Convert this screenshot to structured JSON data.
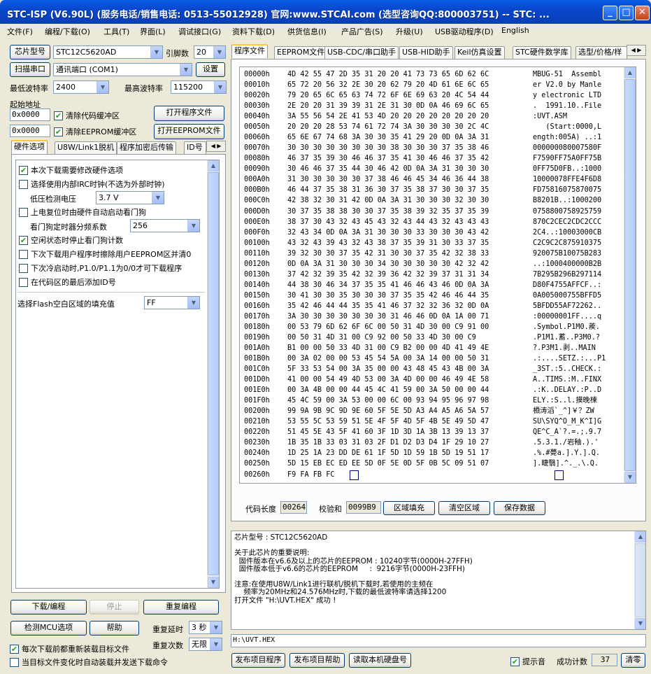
{
  "window": {
    "title": "STC-ISP (V6.90L) (服务电话/销售电话: 0513-55012928) 官网:www.STCAI.com (选型咨询QQ:800003751) -- STC: ..."
  },
  "menu": [
    "文件(F)",
    "编程/下载(O)",
    "工具(T)",
    "界面(L)",
    "调试接口(G)",
    "资料下载(D)",
    "供货信息(I)",
    "产品广告(S)",
    "升级(U)",
    "USB驱动程序(D)",
    "English"
  ],
  "left": {
    "chip_model_btn": "芯片型号",
    "chip_model_value": "STC12C5620AD",
    "pin_label": "引脚数",
    "pin_value": "20",
    "scan_port_btn": "扫描串口",
    "port_value": "通讯端口 (COM1)",
    "settings_btn": "设置",
    "min_baud_label": "最低波特率",
    "min_baud_value": "2400",
    "max_baud_label": "最高波特率",
    "max_baud_value": "115200",
    "start_addr_label": "起始地址",
    "addr1": "0x0000",
    "clear_code_buffer": "清除代码缓冲区",
    "open_program_btn": "打开程序文件",
    "addr2": "0x0000",
    "clear_eeprom_buffer": "清除EEPROM缓冲区",
    "open_eeprom_btn": "打开EEPROM文件",
    "tabs": [
      "硬件选项",
      "U8W/Link1脱机",
      "程序加密后传输",
      "ID号"
    ],
    "hw": {
      "opt1": "本次下载需要修改硬件选项",
      "opt2": "选择使用内部IRC时钟(不选为外部时钟)",
      "voltage_label": "低压检测电压",
      "voltage_value": "3.7 V",
      "opt3": "上电复位时由硬件自动启动看门狗",
      "wdt_label": "看门狗定时器分频系数",
      "wdt_value": "256",
      "opt4": "空闲状态时停止看门狗计数",
      "opt5": "下次下载用户程序时擦除用户EEPROM区并清0",
      "opt6": "下次冷启动时,P1.0/P1.1为0/0才可下载程序",
      "opt7": "在代码区的最后添加ID号",
      "fill_label": "选择Flash空白区域的填充值",
      "fill_value": "FF"
    },
    "download_btn": "下载/编程",
    "stop_btn": "停止",
    "reprogram_btn": "重复编程",
    "detect_btn": "检测MCU选项",
    "help_btn": "帮助",
    "repeat_delay_label": "重复延时",
    "repeat_delay_value": "3 秒",
    "repeat_count_label": "重复次数",
    "repeat_count_value": "无限",
    "reload_each": "每次下载前都重新装载目标文件",
    "auto_send": "当目标文件变化时自动装载并发送下载命令"
  },
  "right": {
    "tabs": [
      "程序文件",
      "EEPROM文件",
      "USB-CDC/串口助手",
      "USB-HID助手",
      "Keil仿真设置",
      "STC硬件数学库",
      "选型/价格/样"
    ],
    "hex": [
      [
        "00000h",
        "4D 42 55 47 2D 35 31 20 20 41 73 73 65 6D 62 6C",
        "MBUG-51  Assembl"
      ],
      [
        "00010h",
        "65 72 20 56 32 2E 30 20 62 79 20 4D 61 6E 6C 65",
        "er V2.0 by Manle"
      ],
      [
        "00020h",
        "79 20 65 6C 65 63 74 72 6F 6E 69 63 20 4C 54 44",
        "y electronic LTD"
      ],
      [
        "00030h",
        "2E 20 20 31 39 39 31 2E 31 30 0D 0A 46 69 6C 65",
        ".  1991.10..File"
      ],
      [
        "00040h",
        "3A 55 56 54 2E 41 53 4D 20 20 20 20 20 20 20 20",
        ":UVT.ASM        "
      ],
      [
        "00050h",
        "20 20 20 28 53 74 61 72 74 3A 30 30 30 30 2C 4C",
        "   (Start:0000,L"
      ],
      [
        "00060h",
        "65 6E 67 74 68 3A 30 30 35 41 29 20 0D 0A 3A 31",
        "ength:005A) ..:1"
      ],
      [
        "00070h",
        "30 30 30 30 30 30 30 30 38 30 30 30 37 35 38 46",
        "000000080007580F"
      ],
      [
        "00080h",
        "46 37 35 39 30 46 46 37 35 41 30 46 46 37 35 42",
        "F7590FF75A0FF75B"
      ],
      [
        "00090h",
        "30 46 46 37 35 44 30 46 42 0D 0A 3A 31 30 30 30",
        "0FF75D0FB..:1000"
      ],
      [
        "000A0h",
        "31 30 30 30 30 30 37 38 46 46 45 34 46 36 44 38",
        "10000078FFE4F6D8"
      ],
      [
        "000B0h",
        "46 44 37 35 38 31 36 30 37 35 38 37 30 30 37 35",
        "FD75816075870075"
      ],
      [
        "000C0h",
        "42 38 32 30 31 42 0D 0A 3A 31 30 30 30 32 30 30",
        "B8201B..:1000200"
      ],
      [
        "000D0h",
        "30 37 35 38 38 30 30 37 35 38 39 32 35 37 35 39",
        "0758800758925759"
      ],
      [
        "000E0h",
        "38 37 30 43 32 43 45 43 32 43 44 43 32 43 43 43",
        "870C2CEC2CDC2CCC"
      ],
      [
        "000F0h",
        "32 43 34 0D 0A 3A 31 30 30 30 33 30 30 30 43 42",
        "2C4..:10003000CB"
      ],
      [
        "00100h",
        "43 32 43 39 43 32 43 38 37 35 39 31 30 33 37 35",
        "C2C9C2C875910375"
      ],
      [
        "00110h",
        "39 32 30 30 37 35 42 31 30 30 37 35 42 32 38 33",
        "920075B10075B283"
      ],
      [
        "00120h",
        "0D 0A 3A 31 30 30 30 34 30 30 30 30 30 42 32 42",
        "..:1000400000B2B"
      ],
      [
        "00130h",
        "37 42 32 39 35 42 32 39 36 42 32 39 37 31 31 34",
        "7B295B296B297114"
      ],
      [
        "00140h",
        "44 38 30 46 34 37 35 35 41 46 46 43 46 0D 0A 3A",
        "D80F4755AFFCF..:"
      ],
      [
        "00150h",
        "30 41 30 30 35 30 30 30 37 35 35 42 46 46 44 35",
        "0A005000755BFFD5"
      ],
      [
        "00160h",
        "35 42 46 44 44 35 35 41 46 37 32 32 36 32 0D 0A",
        "5BFDD55AF72262.."
      ],
      [
        "00170h",
        "3A 30 30 30 30 30 30 30 31 46 46 0D 0A 1A 00 71",
        ":00000001FF....q"
      ],
      [
        "00180h",
        "00 53 79 6D 62 6F 6C 00 50 31 4D 30 00 C9 91 00",
        ".Symbol.P1M0.蒺."
      ],
      [
        "00190h",
        "00 50 31 4D 31 00 C9 92 00 50 33 4D 30 00 C9",
        ".P1M1.蓄..P3M0.?"
      ],
      [
        "001A0h",
        "B1 00 00 50 33 4D 31 00 C9 B2 00 00 4D 41 49 4E",
        "?.P3M1.剥..MAIN"
      ],
      [
        "001B0h",
        "00 3A 02 00 00 53 45 54 5A 00 3A 14 00 00 50 31",
        ".:....SETZ.:...P1"
      ],
      [
        "001C0h",
        "5F 33 53 54 00 3A 35 00 00 43 48 45 43 4B 00 3A",
        "_3ST.:5..CHECK.:"
      ],
      [
        "001D0h",
        "41 00 00 54 49 4D 53 00 3A 4D 00 00 46 49 4E 58",
        "A..TIMS.:M..FINX"
      ],
      [
        "001E0h",
        "00 3A 4B 00 00 44 45 4C 41 59 00 3A 50 00 00 44",
        ".:K..DELAY.:P..D"
      ],
      [
        "001F0h",
        "45 4C 59 00 3A 53 00 00 6C 00 93 94 95 96 97 98",
        "ELY.:S..l.摸晚楝"
      ],
      [
        "00200h",
        "99 9A 9B 9C 9D 9E 60 5F 5E 5D A3 A4 A5 A6 5A 57",
        "槱涛滔`_^]￥？ZW"
      ],
      [
        "00210h",
        "53 55 5C 53 59 51 5E 4F 5F 4D 5F 4B 5E 49 5D 47",
        "SU\\SYQ^O_M_K^I]G"
      ],
      [
        "00220h",
        "51 45 5E 43 5F 41 60 3F 1D 3D 1A 3B 13 39 13 37",
        "QE^C_A`?.=.;.9.7"
      ],
      [
        "00230h",
        "1B 35 1B 33 03 31 03 2F D1 D2 D3 D4 1F 29 10 27",
        ".5.3.1./岩釉.).'"
      ],
      [
        "00240h",
        "1D 25 1A 23 DD DE 61 1F 5D 1D 59 1B 5D 19 51 17",
        ".%.#薨a.].Y.].Q."
      ],
      [
        "00250h",
        "5D 15 EB EC ED EE 5D 0F 5E 0D 5F 0B 5C 09 51 07",
        "].睫翳].^._.\\.Q."
      ],
      [
        "00260h",
        "F9 FA FB FC",
        ""
      ]
    ],
    "code_len_label": "代码长度",
    "code_len_value": "00264",
    "checksum_label": "校验和",
    "checksum_value": "0099B9",
    "fill_area_btn": "区域填充",
    "clear_area_btn": "清空区域",
    "save_data_btn": "保存数据",
    "messages": [
      "芯片型号 : STC12C5620AD",
      "",
      "关于此芯片的重要说明:",
      "  固件版本在v6.6及以上的芯片的EEPROM : 10240字节(0000H-27FFH)",
      "  固件版本低于v6.6的芯片的EEPROM     :  9216字节(0000H-23FFH)",
      "",
      "注意:在使用U8W/Link1进行联机/脱机下载时,若使用的主频在",
      "    频率为20MHz和24.576MHz时,下载的最低波特率请选择1200",
      "打开文件 \"H:\\UVT.HEX\" 成功 !"
    ],
    "path": "H:\\UVT.HEX",
    "publish_prog_btn": "发布项目程序",
    "publish_help_btn": "发布项目帮助",
    "read_disk_btn": "读取本机硬盘号",
    "beep_label": "提示音",
    "success_label": "成功计数",
    "success_value": "37",
    "clear_btn": "清零"
  }
}
